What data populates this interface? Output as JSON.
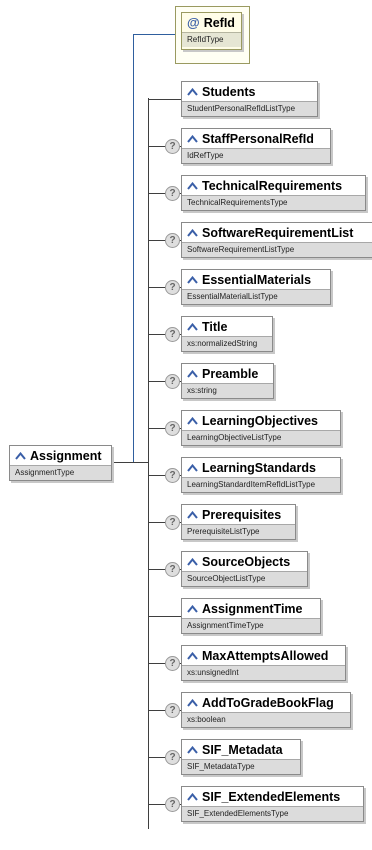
{
  "root": {
    "name": "Assignment",
    "type": "AssignmentType"
  },
  "attribute": {
    "name": "RefId",
    "type": "RefIdType"
  },
  "children": [
    {
      "name": "Students",
      "type": "StudentPersonalRefIdListType",
      "optional": false
    },
    {
      "name": "StaffPersonalRefId",
      "type": "IdRefType",
      "optional": true
    },
    {
      "name": "TechnicalRequirements",
      "type": "TechnicalRequirementsType",
      "optional": true
    },
    {
      "name": "SoftwareRequirementList",
      "type": "SoftwareRequirementListType",
      "optional": true
    },
    {
      "name": "EssentialMaterials",
      "type": "EssentialMaterialListType",
      "optional": true
    },
    {
      "name": "Title",
      "type": "xs:normalizedString",
      "optional": true
    },
    {
      "name": "Preamble",
      "type": "xs:string",
      "optional": true
    },
    {
      "name": "LearningObjectives",
      "type": "LearningObjectiveListType",
      "optional": true
    },
    {
      "name": "LearningStandards",
      "type": "LearningStandardItemRefIdListType",
      "optional": true
    },
    {
      "name": "Prerequisites",
      "type": "PrerequisiteListType",
      "optional": true
    },
    {
      "name": "SourceObjects",
      "type": "SourceObjectListType",
      "optional": true
    },
    {
      "name": "AssignmentTime",
      "type": "AssignmentTimeType",
      "optional": false
    },
    {
      "name": "MaxAttemptsAllowed",
      "type": "xs:unsignedInt",
      "optional": true
    },
    {
      "name": "AddToGradeBookFlag",
      "type": "xs:boolean",
      "optional": true
    },
    {
      "name": "SIF_Metadata",
      "type": "SIF_MetadataType",
      "optional": true
    },
    {
      "name": "SIF_ExtendedElements",
      "type": "SIF_ExtendedElementsType",
      "optional": true
    }
  ],
  "icons": {
    "element": "element-icon",
    "attribute": "attribute-at-icon",
    "optional": "question-mark-icon"
  },
  "colors": {
    "connector": "#3f3f3f",
    "attribute_connector": "#2f5f9e",
    "type_band": "#dcdcdc",
    "attribute_fill": "#fffde8"
  }
}
